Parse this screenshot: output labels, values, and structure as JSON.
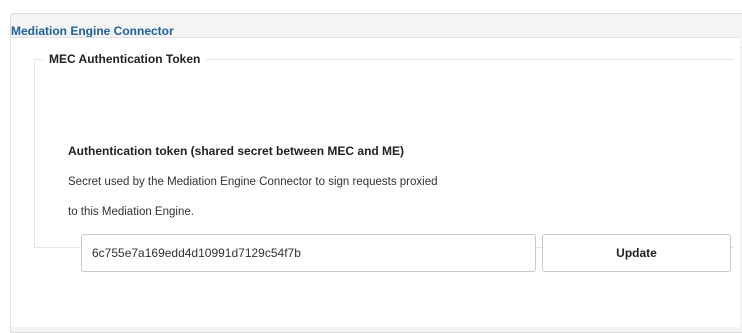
{
  "panel": {
    "title": "Mediation Engine Connector"
  },
  "auth_group": {
    "legend": "MEC Authentication Token",
    "field_label": "Authentication token (shared secret between MEC and ME)",
    "description_line1": "Secret used by the Mediation Engine Connector to sign requests proxied",
    "description_line2": "to this Mediation Engine.",
    "token_value": "6c755e7a169edd4d10991d7129c54f7b",
    "update_label": "Update"
  },
  "colors": {
    "title_blue": "#1f5f9a",
    "panel_bg": "#f4f4f4",
    "border": "#c9c9c9"
  }
}
